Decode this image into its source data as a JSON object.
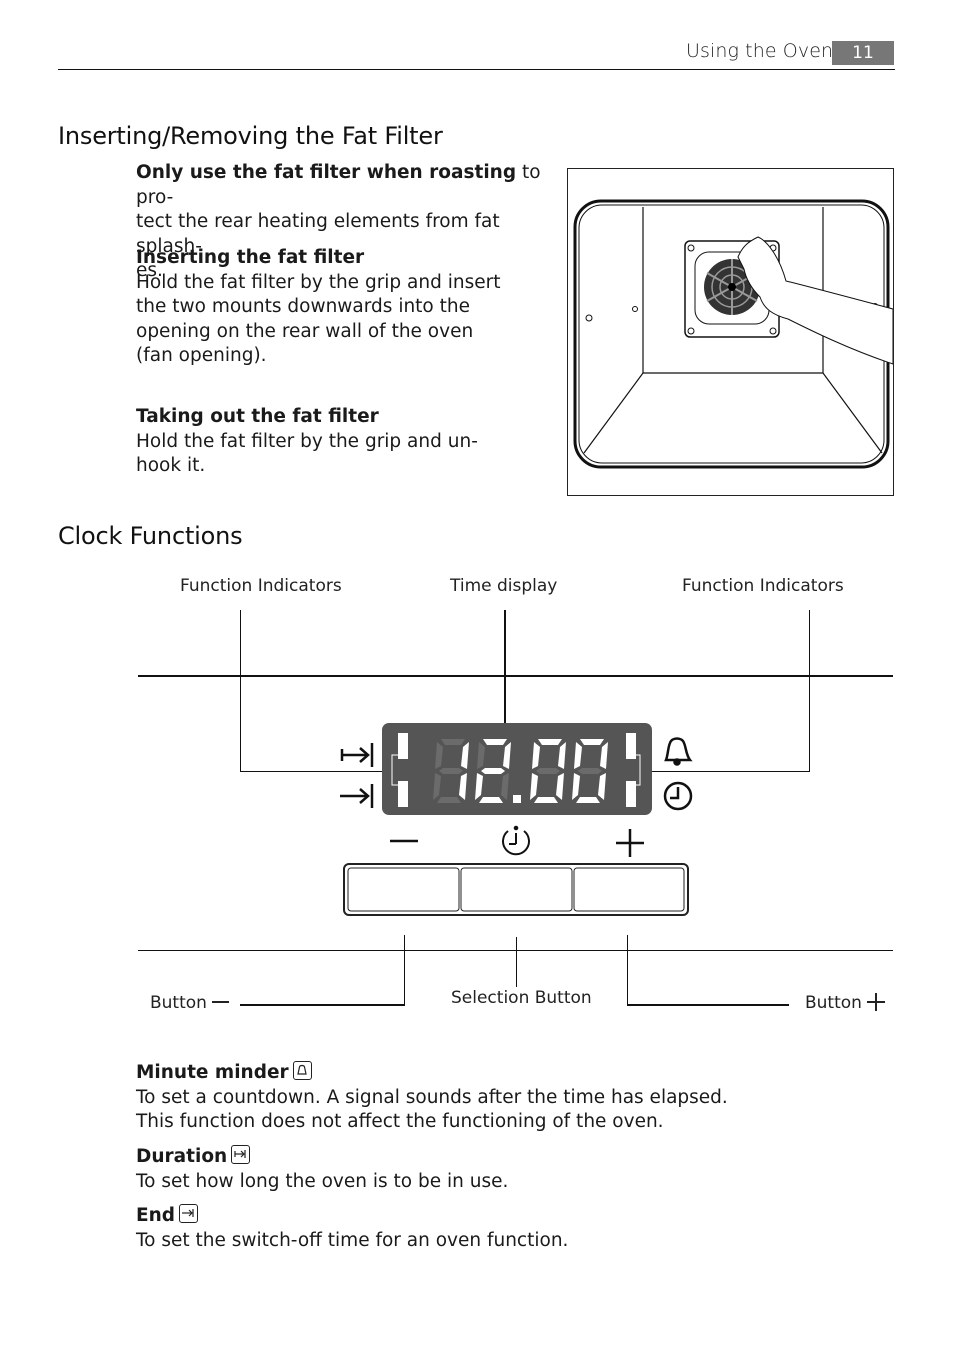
{
  "header": {
    "section_title": "Using the Oven",
    "page_number": "11"
  },
  "fat_filter": {
    "title": "Inserting/Removing the Fat Filter",
    "intro_bold": "Only use the fat filter when roasting",
    "intro_rest_1": " to pro-",
    "intro_line_2": "tect the rear heating elements from fat splash-",
    "intro_line_3": "es.",
    "inserting": {
      "heading": "Inserting the fat filter",
      "lines": [
        "Hold the fat filter by the grip and insert",
        "the two mounts downwards into the",
        "opening on the rear wall of the oven",
        "(fan opening)."
      ]
    },
    "taking_out": {
      "heading": "Taking out the fat filter",
      "lines": [
        "Hold the fat filter by the grip and un-",
        "hook it."
      ]
    },
    "illustration": "oven-interior-with-hand-inserting-fat-filter"
  },
  "clock": {
    "title": "Clock Functions",
    "labels": {
      "function_indicators_left": "Function Indicators",
      "time_display": "Time display",
      "function_indicators_right": "Function Indicators",
      "button_minus": "Button",
      "selection_button": "Selection Button",
      "button_plus": "Button"
    },
    "display_time": "12.00",
    "display_colors": {
      "panel": "#555555",
      "segment_on": "#ffffff",
      "segment_off": "#6b6b6b"
    },
    "icons": [
      "duration-icon",
      "end-icon",
      "bell-icon",
      "clock-icon",
      "minus-icon",
      "selection-icon",
      "plus-icon"
    ]
  },
  "functions": [
    {
      "name": "Minute minder",
      "icon": "bell-icon",
      "lines": [
        "To set a countdown. A signal sounds after the time has elapsed.",
        "This function does not affect the functioning of the oven."
      ]
    },
    {
      "name": "Duration",
      "icon": "duration-icon",
      "lines": [
        "To set how long the oven is to be in use."
      ]
    },
    {
      "name": "End",
      "icon": "end-icon",
      "lines": [
        "To set the switch-off time for an oven function."
      ]
    }
  ]
}
